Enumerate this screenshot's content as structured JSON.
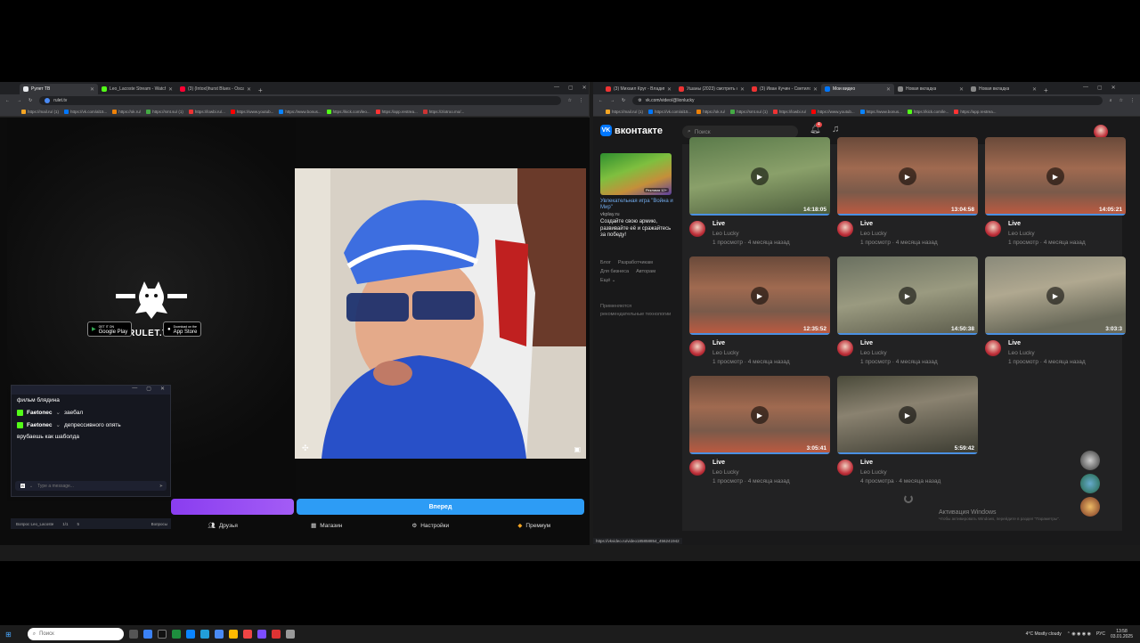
{
  "left_browser": {
    "tabs": [
      {
        "label": "Рулет ТВ",
        "color": "#e8eaed"
      },
      {
        "label": "Leo_Lacoste Stream - Watch Li...",
        "color": "#53fc18"
      },
      {
        "label": "(3) (Intoxi)hurst Blues - Oscar I...",
        "color": "#ff0033"
      }
    ],
    "url": "rulet.tv",
    "bookmarks": [
      "https://mail.ru/ (1)",
      "https://vk.com/al15...",
      "https://ok.ru/",
      "https://smt.su/ (1)",
      "https://lowbi.ru/...",
      "https://www.youtub...",
      "https://www.bonus...",
      "https://kick.com/leo...",
      "https://app.restrea...",
      "https://zlotroo.mo/..."
    ]
  },
  "rulet": {
    "logo_text": "RULET.TV",
    "google_play": {
      "small": "GET IT ON",
      "big": "Google Play"
    },
    "app_store": {
      "small": "Download on the",
      "big": "App Store"
    },
    "start_button": "Вперед",
    "nav": [
      {
        "label": "Друзья",
        "icon": "friends-icon"
      },
      {
        "label": "Магазин",
        "icon": "shop-icon"
      },
      {
        "label": "Настройки",
        "icon": "settings-icon"
      },
      {
        "label": "Премиум",
        "icon": "premium-icon"
      }
    ]
  },
  "chat": {
    "messages": [
      {
        "user": "",
        "text": "фильм блядина"
      },
      {
        "user": "Faetonec",
        "text": "заебал"
      },
      {
        "user": "Faetonec",
        "text": "депрессивного опять"
      },
      {
        "user": "",
        "text": "врубаешь как шаболда"
      }
    ],
    "input_placeholder": "Type a message...",
    "footer_channel": "Вопрос Leo_Lacoste",
    "footer_count": "1/1",
    "footer_viewers": "5",
    "footer_extra": "Вопросы"
  },
  "right_browser": {
    "tabs": [
      "(3) Михаил Круг - Владими...",
      "Ушаны (2023) смотреть о...",
      "(3) Иван Кучин - Светило...",
      "Мои видео",
      "Новая вкладка",
      "Новая вкладка"
    ],
    "url": "vk.com/video/@lionlucky",
    "bookmarks": [
      "https://mail.ru/ (1)",
      "https://vk.com/al15...",
      "https://ok.ru/",
      "https://smt.su/ (1)",
      "https://lowbi.ru/",
      "https://www.youtub...",
      "https://www.bonus...",
      "https://kick.com/le...",
      "https://app.restrea..."
    ]
  },
  "vk": {
    "logo": "вконтакте",
    "search_placeholder": "Поиск",
    "notifications": "4",
    "ad": {
      "badge": "Реклама 12+",
      "title": "Увлекательная игра \"Война и Мир\"",
      "domain": "vkplay.ru",
      "text": "Создайте свою армию, развивайте её и сражайтесь за победу!"
    },
    "footer_links": [
      "Блог",
      "Разработчикам",
      "Для бизнеса",
      "Авторам",
      "Ещё ⌄"
    ],
    "recommend_note": "Применяются рекомендательные технологии",
    "videos": [
      {
        "title": "Live",
        "channel": "Leo Lucky",
        "stats": "1 просмотр · 4 месяца назад",
        "duration": "14:18:05",
        "theme": "green"
      },
      {
        "title": "Live",
        "channel": "Leo Lucky",
        "stats": "1 просмотр · 4 месяца назад",
        "duration": "13:04:58",
        "theme": "gold"
      },
      {
        "title": "Live",
        "channel": "Leo Lucky",
        "stats": "1 просмотр · 4 месяца назад",
        "duration": "14:05:21",
        "theme": "gold"
      },
      {
        "title": "Live",
        "channel": "Leo Lucky",
        "stats": "1 просмотр · 4 месяца назад",
        "duration": "12:35:52",
        "theme": "gold"
      },
      {
        "title": "Live",
        "channel": "Leo Lucky",
        "stats": "1 просмотр · 4 месяца назад",
        "duration": "14:50:38",
        "theme": "gray"
      },
      {
        "title": "Live",
        "channel": "Leo Lucky",
        "stats": "1 просмотр · 4 месяца назад",
        "duration": "3:03:3",
        "theme": "desert"
      },
      {
        "title": "Live",
        "channel": "Leo Lucky",
        "stats": "1 просмотр · 4 месяца назад",
        "duration": "3:05:41",
        "theme": "gold"
      },
      {
        "title": "Live",
        "channel": "Leo Lucky",
        "stats": "4 просмотра · 4 месяца назад",
        "duration": "5:59:42",
        "theme": "city"
      }
    ],
    "status_url": "https://vkvideo.ru/video185858854_456241942"
  },
  "activation": {
    "title": "Активация Windows",
    "sub": "Чтобы активировать Windows, перейдите в раздел \"Параметры\"."
  },
  "taskbar": {
    "search": "Поиск",
    "weather": "4°C  Mostly cloudy",
    "lang": "РУС",
    "time": "13:58",
    "date": "03.01.2025"
  }
}
